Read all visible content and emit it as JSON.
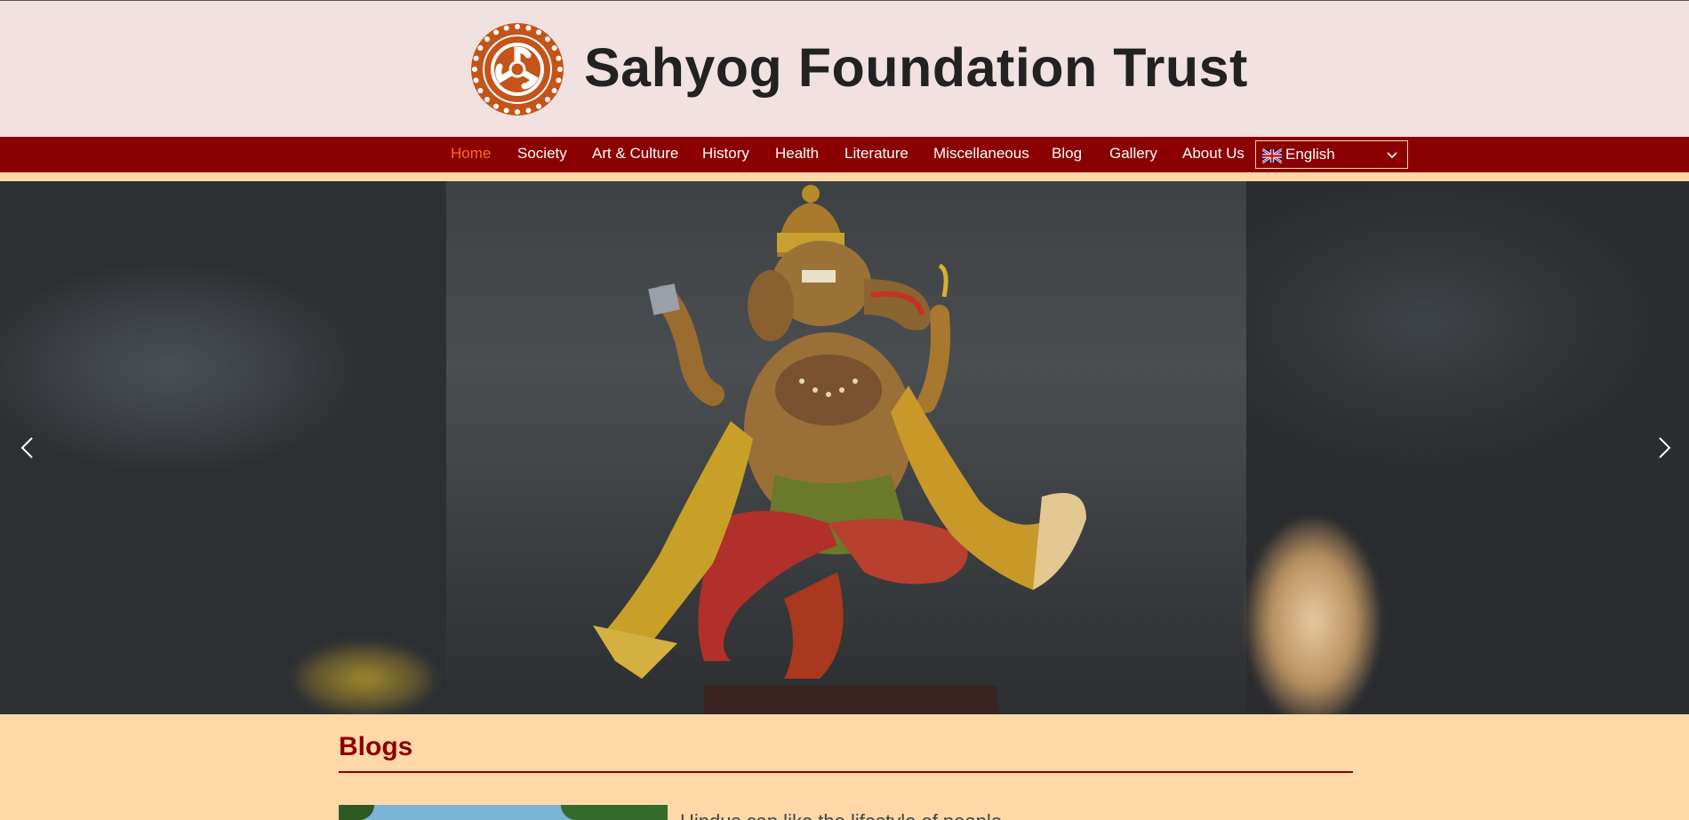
{
  "header": {
    "site_title": "Sahyog Foundation Trust"
  },
  "nav": {
    "items": [
      {
        "label": "Home",
        "active": true
      },
      {
        "label": "Society",
        "active": false
      },
      {
        "label": "Art & Culture",
        "active": false
      },
      {
        "label": "History",
        "active": false
      },
      {
        "label": "Health",
        "active": false
      },
      {
        "label": "Literature",
        "active": false
      },
      {
        "label": "Miscellaneous",
        "active": false
      },
      {
        "label": "Blog",
        "active": false
      },
      {
        "label": "Gallery",
        "active": false
      },
      {
        "label": "About Us",
        "active": false
      }
    ],
    "language": {
      "selected": "English",
      "flag_icon": "uk-flag-icon"
    }
  },
  "slider": {
    "prev_icon": "chevron-left-icon",
    "next_icon": "chevron-right-icon"
  },
  "blogs": {
    "heading": "Blogs",
    "first_excerpt": "Hindus can like the lifestyle of people"
  },
  "colors": {
    "header_bg": "#f2e1e1",
    "nav_bg": "#8b0000",
    "nav_active": "#ff6a2a",
    "page_bg": "#ffd8a8",
    "heading": "#8b0000",
    "logo": "#c4541a"
  }
}
